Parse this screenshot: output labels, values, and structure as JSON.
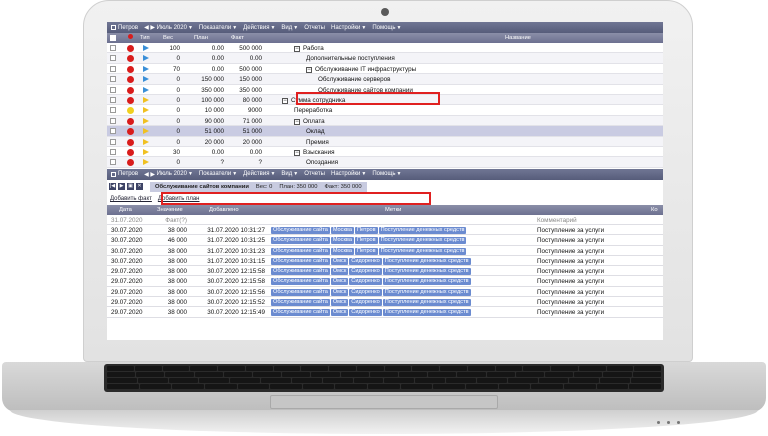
{
  "app": {
    "user": "Петров",
    "period": "Июль 2020",
    "menus": [
      "Показатели",
      "Действия",
      "Вид",
      "Отчеты",
      "Настройки",
      "Помощь"
    ],
    "menu_has_arrow": [
      true,
      true,
      true,
      false,
      true,
      true
    ]
  },
  "tree_headers": {
    "type": "Тип",
    "weight": "Вес",
    "plan": "План",
    "fact": "Факт",
    "name": "Название"
  },
  "tree_rows": [
    {
      "status": "red",
      "flag": "blue",
      "weight": "100",
      "plan": "0.00",
      "fact": "500 000",
      "indent": 0,
      "expander": "−",
      "name": "Работа"
    },
    {
      "status": "red",
      "flag": "blue",
      "weight": "0",
      "plan": "0.00",
      "fact": "0.00",
      "indent": 1,
      "expander": "",
      "name": "Дополнительные поступления"
    },
    {
      "status": "red",
      "flag": "blue",
      "weight": "70",
      "plan": "0.00",
      "fact": "500 000",
      "indent": 1,
      "expander": "−",
      "name": "Обслуживание IT инфраструктуры"
    },
    {
      "status": "red",
      "flag": "blue",
      "weight": "0",
      "plan": "150 000",
      "fact": "150 000",
      "indent": 2,
      "expander": "",
      "name": "Обслуживание серверов"
    },
    {
      "status": "red",
      "flag": "blue",
      "weight": "0",
      "plan": "350 000",
      "fact": "350 000",
      "indent": 2,
      "expander": "",
      "name": "Обслуживание сайтов компании"
    },
    {
      "status": "red",
      "flag": "yellow",
      "weight": "0",
      "plan": "100 000",
      "fact": "80 000",
      "indent": -1,
      "expander": "−",
      "name": "Сумма сотрудника"
    },
    {
      "status": "yellow",
      "flag": "yellow",
      "weight": "0",
      "plan": "10 000",
      "fact": "9000",
      "indent": 0,
      "expander": "",
      "name": "Переработка"
    },
    {
      "status": "red",
      "flag": "yellow",
      "weight": "0",
      "plan": "90 000",
      "fact": "71 000",
      "indent": 0,
      "expander": "−",
      "name": "Оплата"
    },
    {
      "status": "red",
      "flag": "yellow",
      "weight": "0",
      "plan": "51 000",
      "fact": "51 000",
      "indent": 1,
      "expander": "",
      "name": "Оклад"
    },
    {
      "status": "red",
      "flag": "yellow",
      "weight": "0",
      "plan": "20 000",
      "fact": "20 000",
      "indent": 1,
      "expander": "",
      "name": "Премия"
    },
    {
      "status": "red",
      "flag": "yellow",
      "weight": "30",
      "plan": "0.00",
      "fact": "0.00",
      "indent": 0,
      "expander": "−",
      "name": "Взыскания"
    },
    {
      "status": "red",
      "flag": "yellow",
      "weight": "0",
      "plan": "?",
      "fact": "?",
      "indent": 1,
      "expander": "",
      "name": "Опоздания"
    }
  ],
  "selected_row": 8,
  "highlighted_row": 4,
  "info": {
    "name": "Обслуживание сайтов компании",
    "weight": "Вес: 0",
    "plan": "План: 350 000",
    "fact": "Факт: 350 000"
  },
  "links": {
    "add_fact": "Добавить факт",
    "add_plan": "Добавить план"
  },
  "fact_headers": {
    "date": "Дата",
    "value": "Значение",
    "added": "Добавлено",
    "tags": "Метки",
    "comment": "Ко"
  },
  "fact_subheader": {
    "date": "31.07.2020",
    "value": "Факт(?)",
    "comment": "Комментарий"
  },
  "fact_rows": [
    {
      "date": "30.07.2020",
      "value": "38 000",
      "added": "31.07.2020 10:31:27",
      "tags": [
        "Обслуживание сайта",
        "Москва",
        "Петров",
        "Поступление денежных средств"
      ],
      "comment": "Поступление за услуги"
    },
    {
      "date": "30.07.2020",
      "value": "46 000",
      "added": "31.07.2020 10:31:25",
      "tags": [
        "Обслуживание сайта",
        "Москва",
        "Петров",
        "Поступление денежных средств"
      ],
      "comment": "Поступление за услуги"
    },
    {
      "date": "30.07.2020",
      "value": "38 000",
      "added": "31.07.2020 10:31:23",
      "tags": [
        "Обслуживание сайта",
        "Москва",
        "Петров",
        "Поступление денежных средств"
      ],
      "comment": "Поступление за услуги"
    },
    {
      "date": "30.07.2020",
      "value": "38 000",
      "added": "31.07.2020 10:31:15",
      "tags": [
        "Обслуживание сайта",
        "Омск",
        "Сидоренко",
        "Поступление денежных средств"
      ],
      "comment": "Поступление за услуги"
    },
    {
      "date": "29.07.2020",
      "value": "38 000",
      "added": "30.07.2020 12:15:58",
      "tags": [
        "Обслуживание сайта",
        "Омск",
        "Сидоренко",
        "Поступление денежных средств"
      ],
      "comment": "Поступление за услуги"
    },
    {
      "date": "29.07.2020",
      "value": "38 000",
      "added": "30.07.2020 12:15:58",
      "tags": [
        "Обслуживание сайта",
        "Омск",
        "Сидоренко",
        "Поступление денежных средств"
      ],
      "comment": "Поступление за услуги"
    },
    {
      "date": "29.07.2020",
      "value": "38 000",
      "added": "30.07.2020 12:15:56",
      "tags": [
        "Обслуживание сайта",
        "Омск",
        "Сидоренко",
        "Поступление денежных средств"
      ],
      "comment": "Поступление за услуги"
    },
    {
      "date": "29.07.2020",
      "value": "38 000",
      "added": "30.07.2020 12:15:52",
      "tags": [
        "Обслуживание сайта",
        "Омск",
        "Сидоренко",
        "Поступление денежных средств"
      ],
      "comment": "Поступление за услуги"
    },
    {
      "date": "29.07.2020",
      "value": "38 000",
      "added": "30.07.2020 12:15:49",
      "tags": [
        "Обслуживание сайта",
        "Омск",
        "Сидоренко",
        "Поступление денежных средств"
      ],
      "comment": "Поступление за услуги"
    }
  ],
  "colors": {
    "status_red": "#d91c1c",
    "status_yellow": "#f0d020",
    "flag_blue": "#3a8fd8",
    "flag_yellow": "#f0c020",
    "highlight": "#e02020"
  }
}
